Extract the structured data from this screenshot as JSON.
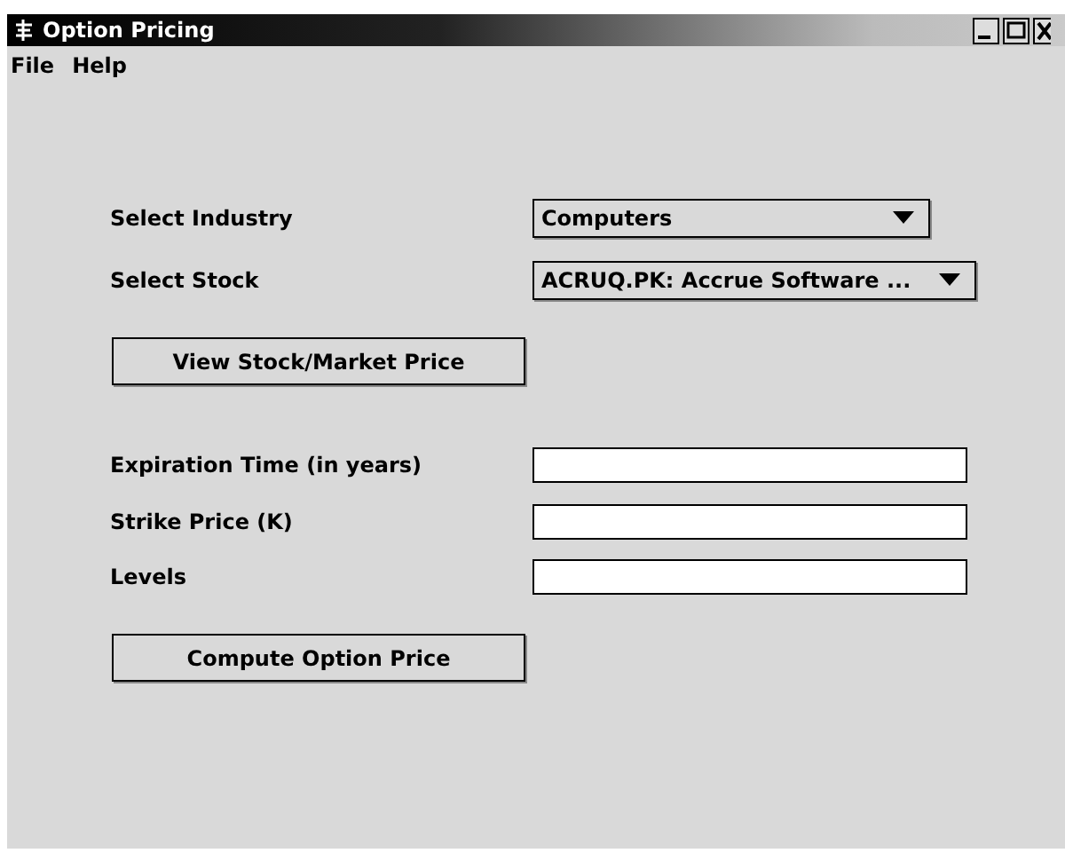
{
  "window": {
    "title": "Option Pricing"
  },
  "menu": [
    "File",
    "Help"
  ],
  "selects": [
    {
      "label": "Select Industry",
      "value": "Computers"
    },
    {
      "label": "Select Stock",
      "value": "ACRUQ.PK: Accrue Software ..."
    }
  ],
  "view_button": "View Stock/Market Price",
  "fields": [
    {
      "label": "Expiration Time (in years)"
    },
    {
      "label": "Strike Price (K)"
    },
    {
      "label": "Levels"
    }
  ],
  "compute_button": "Compute Option Price"
}
